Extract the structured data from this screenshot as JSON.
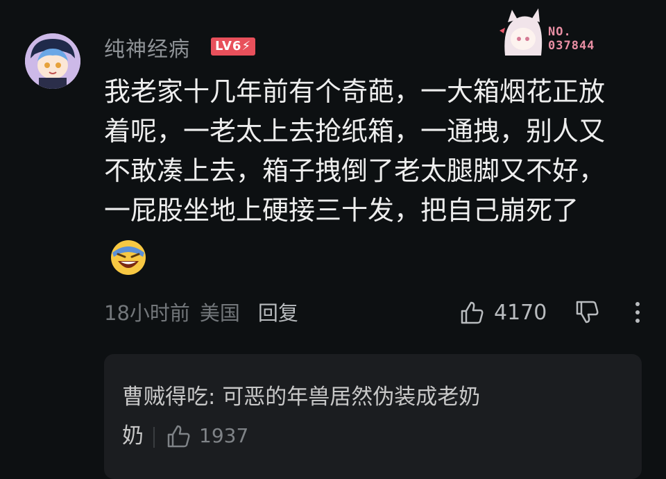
{
  "comment": {
    "username": "纯神经病",
    "level_badge": "LV6",
    "fan_badge": {
      "number_label": "NO.",
      "number": "037844"
    },
    "lines": [
      "我老家十几年前有个奇葩，一大箱烟花正放",
      "着呢，一老太上去抢纸箱，一通拽，别人又",
      "不敢凑上去，箱子拽倒了老太腿脚又不好，",
      "一屁股坐地上硬接三十发，把自己崩死了"
    ],
    "emoji": "laughing-crying-emoji",
    "time": "18小时前",
    "location": "美国",
    "reply_label": "回复",
    "likes": "4170"
  },
  "reply": {
    "author": "曹贼得吃",
    "separator": ": ",
    "text_line1": "可恶的年兽居然伪装成老奶",
    "text_line2": "奶",
    "likes": "1937"
  },
  "colors": {
    "background": "#0d1012",
    "level_badge": "#e8505b",
    "reply_box": "#1b1d20"
  }
}
